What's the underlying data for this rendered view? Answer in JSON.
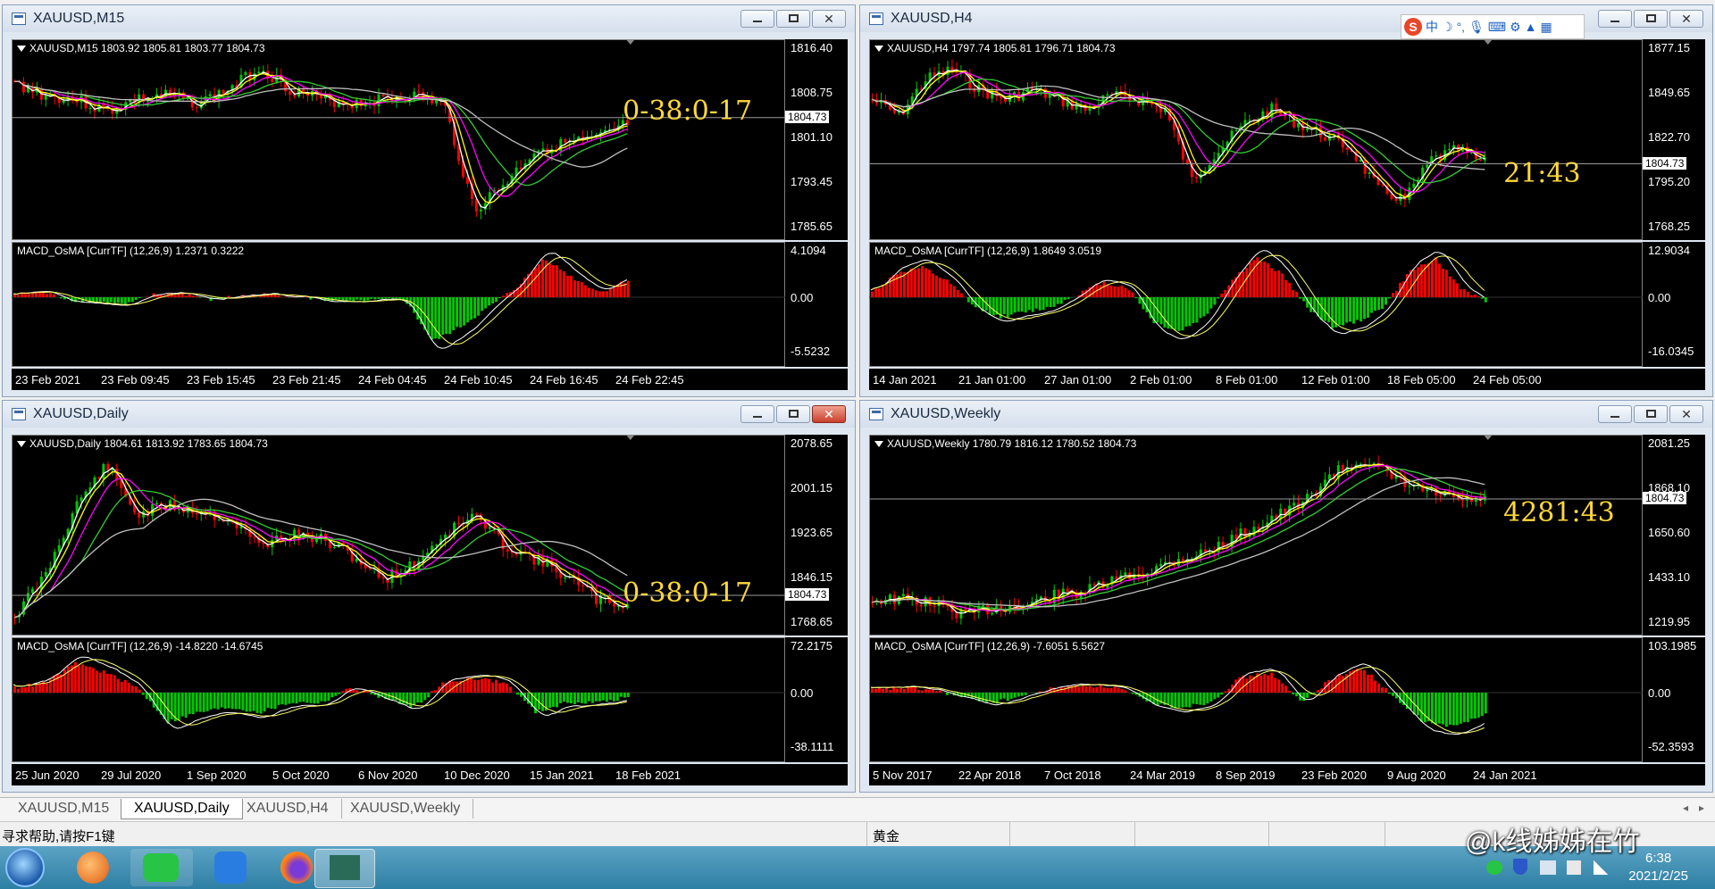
{
  "windows": [
    {
      "id": "m15",
      "title": "XAUUSD,M15",
      "info": "XAUUSD,M15  1803.92 1805.81 1803.77 1804.73",
      "price_labels": [
        "1816.40",
        "1808.75",
        "1801.10",
        "1793.45",
        "1785.65"
      ],
      "current_price": "1804.73",
      "macd_info": "MACD_OsMA [CurrTF] (12,26,9) 1.2371 0.3222",
      "macd_labels": [
        "4.1094",
        "0.00",
        "-5.5232"
      ],
      "dates": [
        "23 Feb 2021",
        "23 Feb 09:45",
        "23 Feb 15:45",
        "23 Feb 21:45",
        "24 Feb 04:45",
        "24 Feb 10:45",
        "24 Feb 16:45",
        "24 Feb 22:45"
      ],
      "countdown": "0-38:0-17",
      "close_style": "normal"
    },
    {
      "id": "h4",
      "title": "XAUUSD,H4",
      "info": "XAUUSD,H4  1797.74 1805.81 1796.71 1804.73",
      "price_labels": [
        "1877.15",
        "1849.65",
        "1822.70",
        "1795.20",
        "1768.25"
      ],
      "current_price": "1804.73",
      "macd_info": "MACD_OsMA [CurrTF] (12,26,9) 1.8649 3.0519",
      "macd_labels": [
        "12.9034",
        "0.00",
        "-16.0345"
      ],
      "dates": [
        "14 Jan 2021",
        "21 Jan 01:00",
        "27 Jan 01:00",
        "2 Feb 01:00",
        "8 Feb 01:00",
        "12 Feb 01:00",
        "18 Feb 05:00",
        "24 Feb 05:00"
      ],
      "countdown": "21:43",
      "close_style": "normal"
    },
    {
      "id": "daily",
      "title": "XAUUSD,Daily",
      "info": "XAUUSD,Daily  1804.61 1813.92 1783.65 1804.73",
      "price_labels": [
        "2078.65",
        "2001.15",
        "1923.65",
        "1846.15",
        "1768.65"
      ],
      "current_price": "1804.73",
      "macd_info": "MACD_OsMA [CurrTF] (12,26,9) -14.8220 -14.6745",
      "macd_labels": [
        "72.2175",
        "0.00",
        "-38.1111"
      ],
      "dates": [
        "25 Jun 2020",
        "29 Jul 2020",
        "1 Sep 2020",
        "5 Oct 2020",
        "6 Nov 2020",
        "10 Dec 2020",
        "15 Jan 2021",
        "18 Feb 2021"
      ],
      "countdown": "0-38:0-17",
      "close_style": "red"
    },
    {
      "id": "weekly",
      "title": "XAUUSD,Weekly",
      "info": "XAUUSD,Weekly  1780.79 1816.12 1780.52 1804.73",
      "price_labels": [
        "2081.25",
        "1868.10",
        "1650.60",
        "1433.10",
        "1219.95"
      ],
      "current_price": "1804.73",
      "macd_info": "MACD_OsMA [CurrTF] (12,26,9) -7.6051 5.5627",
      "macd_labels": [
        "103.1985",
        "0.00",
        "-52.3593"
      ],
      "dates": [
        "5 Nov 2017",
        "22 Apr 2018",
        "7 Oct 2018",
        "24 Mar 2019",
        "8 Sep 2019",
        "23 Feb 2020",
        "9 Aug 2020",
        "24 Jan 2021"
      ],
      "countdown": "4281:43",
      "close_style": "normal"
    }
  ],
  "tabs": [
    "XAUUSD,M15",
    "XAUUSD,Daily",
    "XAUUSD,H4",
    "XAUUSD,Weekly"
  ],
  "active_tab": 1,
  "status": {
    "help": "寻求帮助,请按F1键",
    "profile": "黄金"
  },
  "ime": {
    "logo": "S",
    "lang": "中"
  },
  "taskbar": {
    "time": "6:38",
    "date": "2021/2/25"
  },
  "watermark": "@k线姊姊在竹",
  "colors": {
    "bull": "#00c800",
    "bear": "#ff0000",
    "ma_white": "#ffffff",
    "ma_yellow": "#ffff00",
    "ma_magenta": "#ff00ff",
    "ma_green": "#32cd32",
    "ma_gray": "#c0c0c0",
    "countdown": "#ffd83a"
  }
}
